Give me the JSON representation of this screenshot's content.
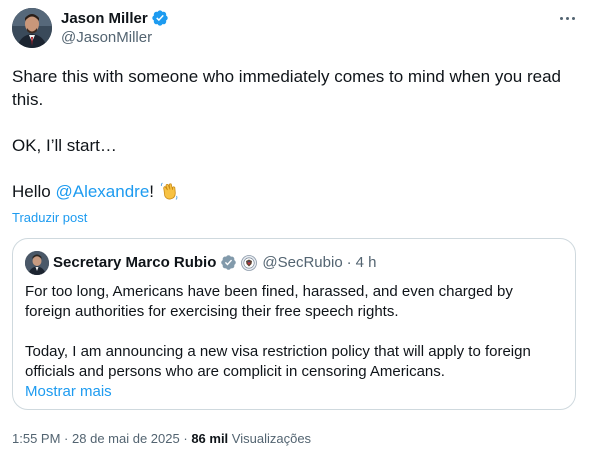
{
  "author": {
    "display_name": "Jason Miller",
    "handle": "@JasonMiller",
    "avatar_icon": "profile-photo"
  },
  "tweet": {
    "line1": "Share this with someone who immediately comes to mind when you read this.",
    "line2": "OK, I’ll start…",
    "line3_prefix": "Hello ",
    "line3_mention": "@Alexandre",
    "line3_suffix": "!",
    "emoji": "waving-hand-icon",
    "translate_label": "Traduzir post"
  },
  "quoted_post": {
    "display_name": "Secretary Marco Rubio",
    "handle": "@SecRubio",
    "separator": "·",
    "time": "4 h",
    "paragraph1": "For too long, Americans have been fined, harassed, and even charged by foreign authorities for exercising their free speech rights.",
    "paragraph2": "Today, I am announcing a new visa restriction policy that will apply to foreign officials and persons who are complicit in censoring Americans.",
    "show_more": "Mostrar mais"
  },
  "meta": {
    "time": "1:55 PM",
    "dot1": "·",
    "date": "28 de mai de 2025",
    "dot2": "·",
    "views_count": "86 mil",
    "views_label": "Visualizações"
  },
  "colors": {
    "link": "#1d9bf0",
    "secondary_text": "#536471",
    "primary_text": "#0f1419",
    "border": "#cfd9de",
    "gov_badge": "#829aab"
  }
}
